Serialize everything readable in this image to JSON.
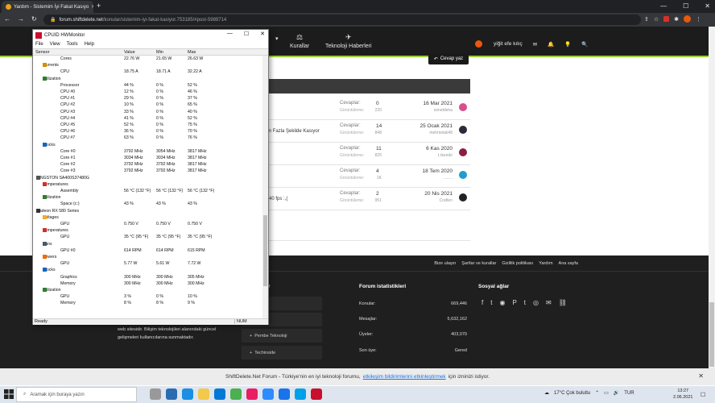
{
  "browser": {
    "tab_title": "Yardım - Sistemim İyi Fakat Kasıyo",
    "url_domain": "forum.shiftdelete.net",
    "url_path": "/konular/sistemim-iyi-fakat-kasiyor.753185/#post-5989714"
  },
  "site": {
    "nav": [
      {
        "label": "Kurallar",
        "icon": "scales-icon"
      },
      {
        "label": "Teknoloji Haberleri",
        "icon": "rocket-icon"
      }
    ],
    "username": "yiğit efe kılıç",
    "reply_button": "Cevap yaz"
  },
  "threads": [
    {
      "title": "",
      "replies_label": "Cevaplar:",
      "replies": "0",
      "views_label": "Görüntüleme:",
      "views": "220",
      "date": "16 Mar 2021",
      "user": "ismetdeha",
      "avatar_color": "#d94f8a"
    },
    {
      "title": "m Fazla Şekilde Kasıyor",
      "replies_label": "Cevaplar:",
      "replies": "14",
      "views_label": "Görüntüleme:",
      "views": "848",
      "date": "25 Ocak 2021",
      "user": "mehmetali48",
      "avatar_color": "#2b2b3a"
    },
    {
      "title": "",
      "replies_label": "Cevaplar:",
      "replies": "11",
      "views_label": "Görüntüleme:",
      "views": "825",
      "date": "6 Kas 2020",
      "user": "Lrkende",
      "avatar_color": "#8a2040"
    },
    {
      "title": "",
      "replies_label": "Cevaplar:",
      "replies": "4",
      "views_label": "Görüntüleme:",
      "views": "1K",
      "date": "18 Tem 2020",
      "user": "........",
      "avatar_color": "#1f9ec9"
    },
    {
      "title": "-40 fps :,(",
      "replies_label": "Cevaplar:",
      "replies": "2",
      "views_label": "Görüntüleme:",
      "views": "951",
      "date": "20 Nis 2021",
      "user": "Craften",
      "avatar_color": "#222222"
    }
  ],
  "footer": {
    "links": [
      "Bize ulaşın",
      "Şartlar ve kurallar",
      "Gizlilik politikası",
      "Yardım",
      "Ana sayfa"
    ],
    "about": "web sitesidir. Bilişim teknolojileri alanındaki güncel gelişmeleri kullanıcılarına sunmaktadır.",
    "sites_title": "r",
    "sites": [
      "at",
      "lma",
      "Pembe Teknoloji",
      "Techinside"
    ],
    "stats_title": "Forum istatistikleri",
    "stats": [
      {
        "label": "Konular:",
        "value": "669,446"
      },
      {
        "label": "Mesajlar:",
        "value": "5,632,162"
      },
      {
        "label": "Üyeler:",
        "value": "403,070"
      },
      {
        "label": "Son üye:",
        "value": "Gered"
      }
    ],
    "social_title": "Sosyal ağlar"
  },
  "cookie": {
    "pre": "ShiftDelete.Net Forum - Türkiye'nin en iyi teknoloji forumu,",
    "link": "etkileşim bildirimlerini etkinleştirmek",
    "post": "için izninizi istiyor."
  },
  "taskbar": {
    "search_placeholder": "Aramak için buraya yazın",
    "weather": "17°C  Çok bulutlu",
    "lang": "TUR",
    "time": "13:27",
    "date": "2.06.2021"
  },
  "hwmonitor": {
    "title": "CPUID HWMonitor",
    "menu": [
      "File",
      "View",
      "Tools",
      "Help"
    ],
    "columns": [
      "Sensor",
      "Value",
      "Min",
      "Max"
    ],
    "rows": [
      {
        "level": 4,
        "name": "Cores",
        "value": "22.76 W",
        "min": "21.65 W",
        "max": "26.63 W"
      },
      {
        "level": 2,
        "name": "Currents",
        "group": true,
        "icon": "current-icon"
      },
      {
        "level": 4,
        "name": "CPU",
        "value": "18.75 A",
        "min": "18.71 A",
        "max": "32.22 A"
      },
      {
        "level": 2,
        "name": "Utilization",
        "group": true,
        "icon": "utilization-icon"
      },
      {
        "level": 4,
        "name": "Processor",
        "value": "44 %",
        "min": "0 %",
        "max": "52 %"
      },
      {
        "level": 4,
        "name": "CPU #0",
        "value": "12 %",
        "min": "0 %",
        "max": "46 %"
      },
      {
        "level": 4,
        "name": "CPU #1",
        "value": "29 %",
        "min": "0 %",
        "max": "37 %"
      },
      {
        "level": 4,
        "name": "CPU #2",
        "value": "10 %",
        "min": "0 %",
        "max": "65 %"
      },
      {
        "level": 4,
        "name": "CPU #3",
        "value": "33 %",
        "min": "0 %",
        "max": "40 %"
      },
      {
        "level": 4,
        "name": "CPU #4",
        "value": "41 %",
        "min": "0 %",
        "max": "52 %"
      },
      {
        "level": 4,
        "name": "CPU #5",
        "value": "52 %",
        "min": "0 %",
        "max": "75 %"
      },
      {
        "level": 4,
        "name": "CPU #6",
        "value": "36 %",
        "min": "0 %",
        "max": "70 %"
      },
      {
        "level": 4,
        "name": "CPU #7",
        "value": "63 %",
        "min": "0 %",
        "max": "76 %"
      },
      {
        "level": 2,
        "name": "Clocks",
        "group": true,
        "icon": "clock-icon"
      },
      {
        "level": 4,
        "name": "Core #0",
        "value": "3792 MHz",
        "min": "3054 MHz",
        "max": "3817 MHz"
      },
      {
        "level": 4,
        "name": "Core #1",
        "value": "3034 MHz",
        "min": "3034 MHz",
        "max": "3817 MHz"
      },
      {
        "level": 4,
        "name": "Core #2",
        "value": "3792 MHz",
        "min": "3792 MHz",
        "max": "3817 MHz"
      },
      {
        "level": 4,
        "name": "Core #3",
        "value": "3792 MHz",
        "min": "3792 MHz",
        "max": "3817 MHz"
      },
      {
        "level": 1,
        "name": "KINGSTON SA400S37480G",
        "group": true,
        "icon": "drive-icon"
      },
      {
        "level": 2,
        "name": "Temperatures",
        "group": true,
        "icon": "thermometer-icon"
      },
      {
        "level": 4,
        "name": "Assembly",
        "value": "56 °C  (132 °F)",
        "min": "56 °C  (132 °F)",
        "max": "56 °C  (132 °F)"
      },
      {
        "level": 2,
        "name": "Utilization",
        "group": true,
        "icon": "utilization-icon"
      },
      {
        "level": 4,
        "name": "Space (c:)",
        "value": "43 %",
        "min": "43 %",
        "max": "43 %"
      },
      {
        "level": 1,
        "name": "Radeon RX 580 Series",
        "group": true,
        "icon": "gpu-icon"
      },
      {
        "level": 2,
        "name": "Voltages",
        "group": true,
        "icon": "voltage-icon"
      },
      {
        "level": 4,
        "name": "GPU",
        "value": "0.750 V",
        "min": "0.750 V",
        "max": "0.750 V"
      },
      {
        "level": 2,
        "name": "Temperatures",
        "group": true,
        "icon": "thermometer-icon"
      },
      {
        "level": 4,
        "name": "GPU",
        "value": "35 °C  (95 °F)",
        "min": "35 °C  (95 °F)",
        "max": "35 °C  (95 °F)"
      },
      {
        "level": 2,
        "name": "Fans",
        "group": true,
        "icon": "fan-icon"
      },
      {
        "level": 4,
        "name": "GPU #0",
        "value": "614 RPM",
        "min": "614 RPM",
        "max": "615 RPM"
      },
      {
        "level": 2,
        "name": "Powers",
        "group": true,
        "icon": "power-icon"
      },
      {
        "level": 4,
        "name": "GPU",
        "value": "5.77 W",
        "min": "5.61 W",
        "max": "7.72 W"
      },
      {
        "level": 2,
        "name": "Clocks",
        "group": true,
        "icon": "clock-icon"
      },
      {
        "level": 4,
        "name": "Graphics",
        "value": "300 MHz",
        "min": "300 MHz",
        "max": "305 MHz"
      },
      {
        "level": 4,
        "name": "Memory",
        "value": "300 MHz",
        "min": "300 MHz",
        "max": "300 MHz"
      },
      {
        "level": 2,
        "name": "Utilization",
        "group": true,
        "icon": "utilization-icon"
      },
      {
        "level": 4,
        "name": "GPU",
        "value": "3 %",
        "min": "0 %",
        "max": "10 %"
      },
      {
        "level": 4,
        "name": "Memory",
        "value": "8 %",
        "min": "8 %",
        "max": "9 %"
      }
    ],
    "status": "Ready",
    "num": "NUM"
  }
}
